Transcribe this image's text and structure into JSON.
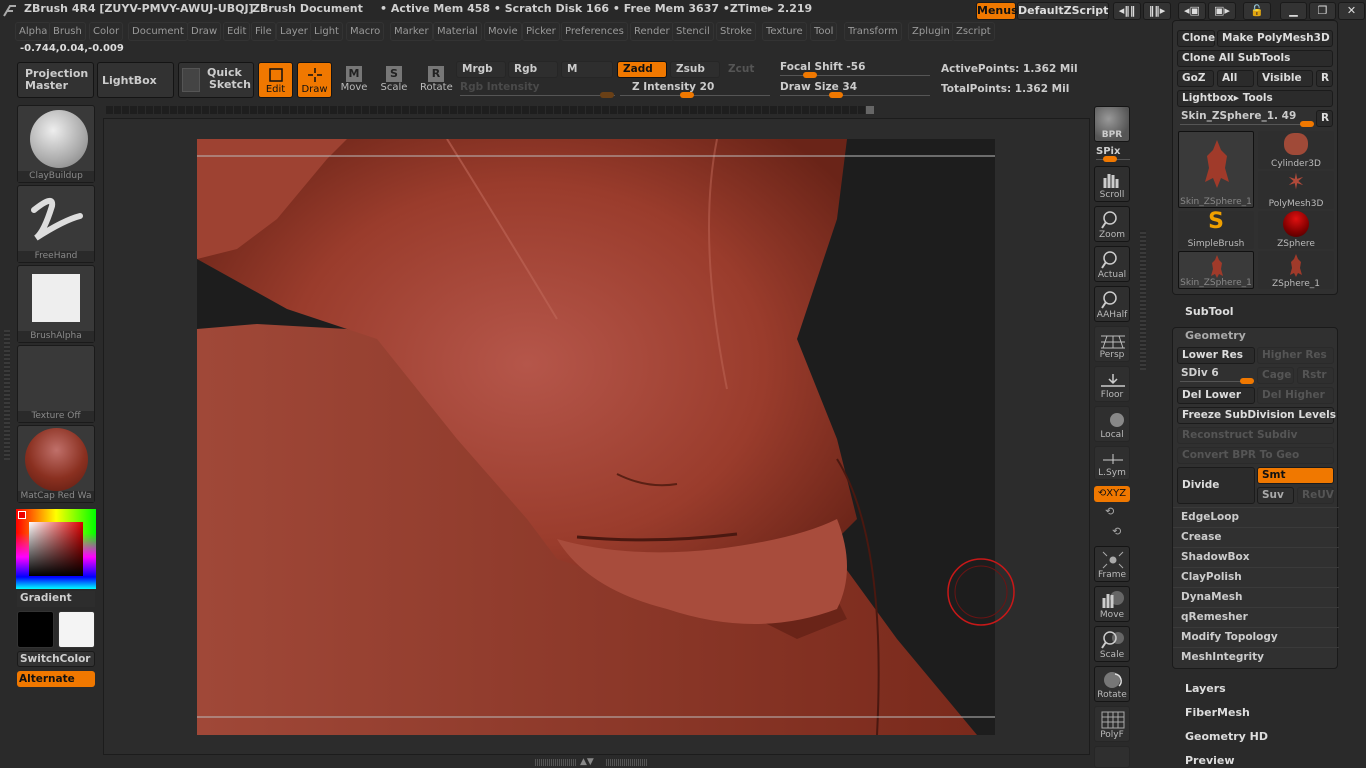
{
  "titlebar": {
    "app": "ZBrush 4R4 [ZUYV-PMVY-AWUJ-UBQJ]",
    "doc": "ZBrush Document",
    "status": "• Active Mem 458 • Scratch Disk 166 • Free Mem 3637 •ZTime▸ 2.219",
    "menus_btn": "Menus",
    "script_btn": "DefaultZScript"
  },
  "menubar": [
    "Alpha",
    "Brush",
    "Color",
    "Document",
    "Draw",
    "Edit",
    "File",
    "Layer",
    "Light",
    "Macro",
    "Marker",
    "Material",
    "Movie",
    "Picker",
    "Preferences",
    "Render",
    "Stencil",
    "Stroke",
    "Texture",
    "Tool",
    "Transform",
    "Zplugin",
    "Zscript"
  ],
  "coords": "-0.744,0.04,-0.009",
  "toolbar": {
    "projection_master": "Projection Master",
    "lightbox": "LightBox",
    "quick_sketch_1": "Quick",
    "quick_sketch_2": "Sketch",
    "edit": "Edit",
    "draw": "Draw",
    "move": "Move",
    "scale": "Scale",
    "rotate": "Rotate",
    "mrgb": "Mrgb",
    "rgb": "Rgb",
    "m": "M",
    "rgb_intensity": "Rgb Intensity",
    "zadd": "Zadd",
    "zsub": "Zsub",
    "zcut": "Zcut",
    "z_intensity": "Z Intensity 20",
    "focal_shift": "Focal Shift -56",
    "draw_size": "Draw Size 34",
    "active_points": "ActivePoints: 1.362 Mil",
    "total_points": "TotalPoints: 1.362 Mil"
  },
  "sliders": {
    "z_intensity": 20,
    "focal_shift": -56,
    "draw_size": 34
  },
  "left": {
    "brush": "ClayBuildup",
    "stroke": "FreeHand",
    "alpha": "BrushAlpha",
    "texture": "Texture Off",
    "material": "MatCap Red Wa",
    "gradient": "Gradient",
    "switch_color": "SwitchColor",
    "alternate": "Alternate"
  },
  "right_shelf": {
    "bpr": "BPR",
    "spix": "SPix",
    "scroll": "Scroll",
    "zoom": "Zoom",
    "actual": "Actual",
    "aahalf": "AAHalf",
    "persp": "Persp",
    "floor": "Floor",
    "local": "Local",
    "lsym": "L.Sym",
    "xyz": "XYZ",
    "frame": "Frame",
    "move": "Move",
    "scale": "Scale",
    "rotate": "Rotate",
    "polyf": "PolyF"
  },
  "tool_panel": {
    "clone": "Clone",
    "make_polymesh": "Make PolyMesh3D",
    "clone_all": "Clone All SubTools",
    "goz": "GoZ",
    "all": "All",
    "visible": "Visible",
    "r": "R",
    "lightbox_tools": "Lightbox▸ Tools",
    "current_tool": "Skin_ZSphere_1. 49",
    "thumbs": [
      "Skin_ZSphere_1",
      "Cylinder3D",
      "PolyMesh3D",
      "SimpleBrush",
      "ZSphere",
      "Skin_ZSphere_1",
      "ZSphere_1"
    ],
    "subtool": "SubTool",
    "geometry": "Geometry",
    "lower_res": "Lower Res",
    "higher_res": "Higher Res",
    "sdiv": "SDiv 6",
    "cage": "Cage",
    "rstr": "Rstr",
    "del_lower": "Del Lower",
    "del_higher": "Del Higher",
    "freeze": "Freeze SubDivision Levels",
    "reconstruct": "Reconstruct Subdiv",
    "convert_bpr": "Convert BPR To Geo",
    "divide": "Divide",
    "smt": "Smt",
    "suv": "Suv",
    "reuv": "ReUV",
    "geo_items": [
      "EdgeLoop",
      "Crease",
      "ShadowBox",
      "ClayPolish",
      "DynaMesh",
      "qRemesher",
      "Modify Topology",
      "MeshIntegrity"
    ],
    "sections": [
      "Layers",
      "FiberMesh",
      "Geometry HD",
      "Preview"
    ]
  },
  "colors": {
    "accent": "#f07800",
    "mesh": "#9a3c2c",
    "bg": "#2a2a2a"
  }
}
